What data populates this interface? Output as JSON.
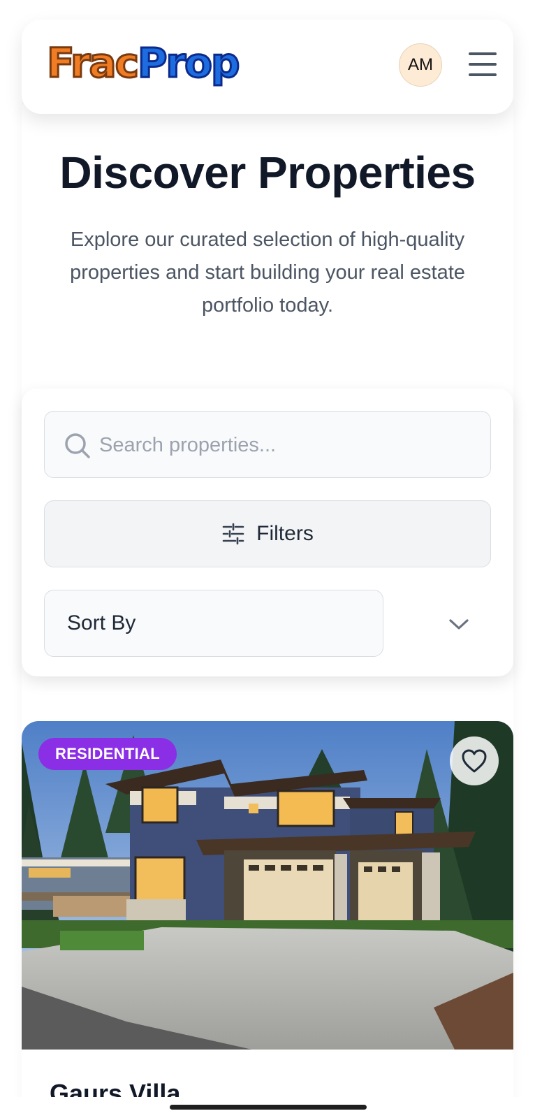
{
  "header": {
    "logo_part1": "Frac",
    "logo_part2": "Prop",
    "avatar_initials": "AM"
  },
  "hero": {
    "title": "Discover Properties",
    "subtitle": "Explore our curated selection of high-quality properties and start building your real estate portfolio today."
  },
  "filters": {
    "search_placeholder": "Search properties...",
    "filters_label": "Filters",
    "sort_label": "Sort By"
  },
  "property": {
    "category_badge": "RESIDENTIAL",
    "title": "Gaurs Villa",
    "favorited": false
  },
  "colors": {
    "brand_orange": "#f07d24",
    "brand_blue": "#1e6de0",
    "badge_purple": "#8b2fe6",
    "avatar_bg": "#fdebd5"
  },
  "icons": [
    "menu-icon",
    "search-icon",
    "sliders-icon",
    "chevron-down-icon",
    "heart-icon"
  ]
}
